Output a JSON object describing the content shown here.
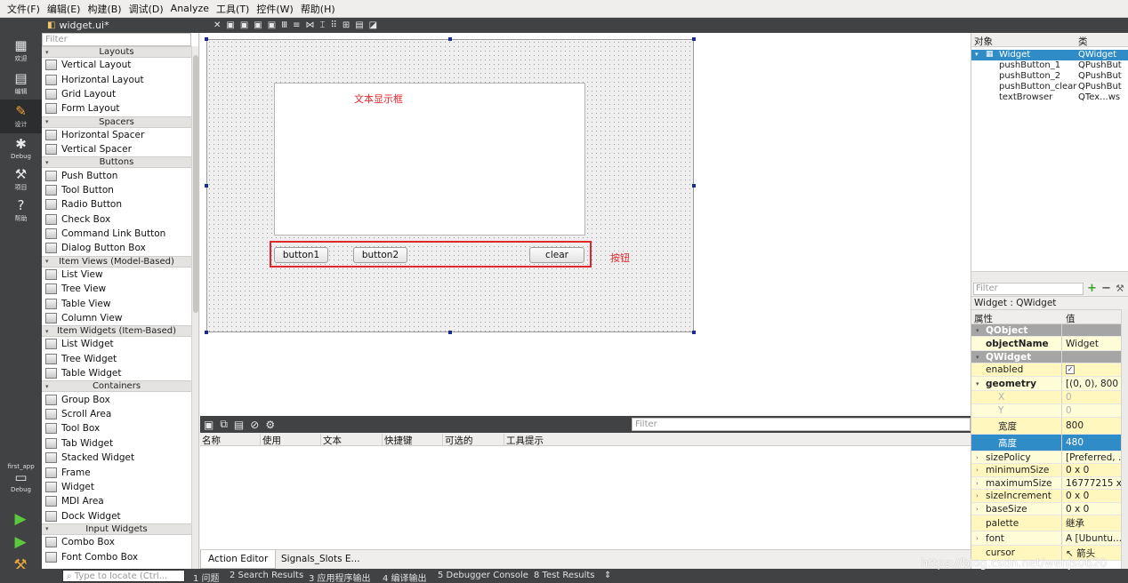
{
  "menubar": [
    "文件(F)",
    "编辑(E)",
    "构建(B)",
    "调试(D)",
    "Analyze",
    "工具(T)",
    "控件(W)",
    "帮助(H)"
  ],
  "modebar": {
    "welcome": "欢迎",
    "edit": "编辑",
    "design": "设计",
    "debug": "Debug",
    "projects": "项目",
    "help": "帮助",
    "target_project": "first_app",
    "target_mode": "Debug"
  },
  "document": {
    "file": "widget.ui*"
  },
  "widgetbox": {
    "filter_placeholder": "Filter",
    "categories": [
      {
        "name": "Layouts",
        "items": [
          "Vertical Layout",
          "Horizontal Layout",
          "Grid Layout",
          "Form Layout"
        ]
      },
      {
        "name": "Spacers",
        "items": [
          "Horizontal Spacer",
          "Vertical Spacer"
        ]
      },
      {
        "name": "Buttons",
        "items": [
          "Push Button",
          "Tool Button",
          "Radio Button",
          "Check Box",
          "Command Link Button",
          "Dialog Button Box"
        ]
      },
      {
        "name": "Item Views (Model-Based)",
        "items": [
          "List View",
          "Tree View",
          "Table View",
          "Column View"
        ]
      },
      {
        "name": "Item Widgets (Item-Based)",
        "items": [
          "List Widget",
          "Tree Widget",
          "Table Widget"
        ]
      },
      {
        "name": "Containers",
        "items": [
          "Group Box",
          "Scroll Area",
          "Tool Box",
          "Tab Widget",
          "Stacked Widget",
          "Frame",
          "Widget",
          "MDI Area",
          "Dock Widget"
        ]
      },
      {
        "name": "Input Widgets",
        "items": [
          "Combo Box",
          "Font Combo Box"
        ]
      }
    ]
  },
  "form": {
    "textbox_label": "文本显示框",
    "button1": "button1",
    "button2": "button2",
    "clear": "clear",
    "buttons_note": "按钮"
  },
  "action_editor": {
    "filter_placeholder": "Filter",
    "columns": [
      "名称",
      "使用",
      "文本",
      "快捷键",
      "可选的",
      "工具提示"
    ],
    "tabs": [
      "Action Editor",
      "Signals_Slots E..."
    ]
  },
  "object_inspector": {
    "col_object": "对象",
    "col_class": "类",
    "rows": [
      {
        "name": "Widget",
        "class": "QWidget"
      },
      {
        "name": "pushButton_1",
        "class": "QPushBut"
      },
      {
        "name": "pushButton_2",
        "class": "QPushBut"
      },
      {
        "name": "pushButton_clear",
        "class": "QPushBut"
      },
      {
        "name": "textBrowser",
        "class": "QTex...ws"
      }
    ]
  },
  "property_editor": {
    "filter_placeholder": "Filter",
    "class_label": "Widget : QWidget",
    "col_property": "属性",
    "col_value": "值",
    "rows": [
      {
        "name": "QObject",
        "value": ""
      },
      {
        "name": "objectName",
        "value": "Widget"
      },
      {
        "name": "QWidget",
        "value": ""
      },
      {
        "name": "enabled",
        "value": "✓"
      },
      {
        "name": "geometry",
        "value": "[(0, 0), 800 ..."
      },
      {
        "name": "X",
        "value": "0"
      },
      {
        "name": "Y",
        "value": "0"
      },
      {
        "name": "宽度",
        "value": "800"
      },
      {
        "name": "高度",
        "value": "480"
      },
      {
        "name": "sizePolicy",
        "value": "[Preferred, ..."
      },
      {
        "name": "minimumSize",
        "value": "0 x 0"
      },
      {
        "name": "maximumSize",
        "value": "16777215 x..."
      },
      {
        "name": "sizeIncrement",
        "value": "0 x 0"
      },
      {
        "name": "baseSize",
        "value": "0 x 0"
      },
      {
        "name": "palette",
        "value": "继承"
      },
      {
        "name": "font",
        "value": "A  [Ubuntu..."
      },
      {
        "name": "cursor",
        "value": "↖ 箭头"
      }
    ]
  },
  "statusbar": {
    "locator_placeholder": "Type to locate (Ctrl...",
    "items": [
      "1 问题",
      "2 Search Results",
      "3 应用程序输出",
      "4 编译输出",
      "5 Debugger Console",
      "8 Test Results",
      "⇕"
    ]
  },
  "watermark": "https://blog.csdn.net/wenjs0620"
}
